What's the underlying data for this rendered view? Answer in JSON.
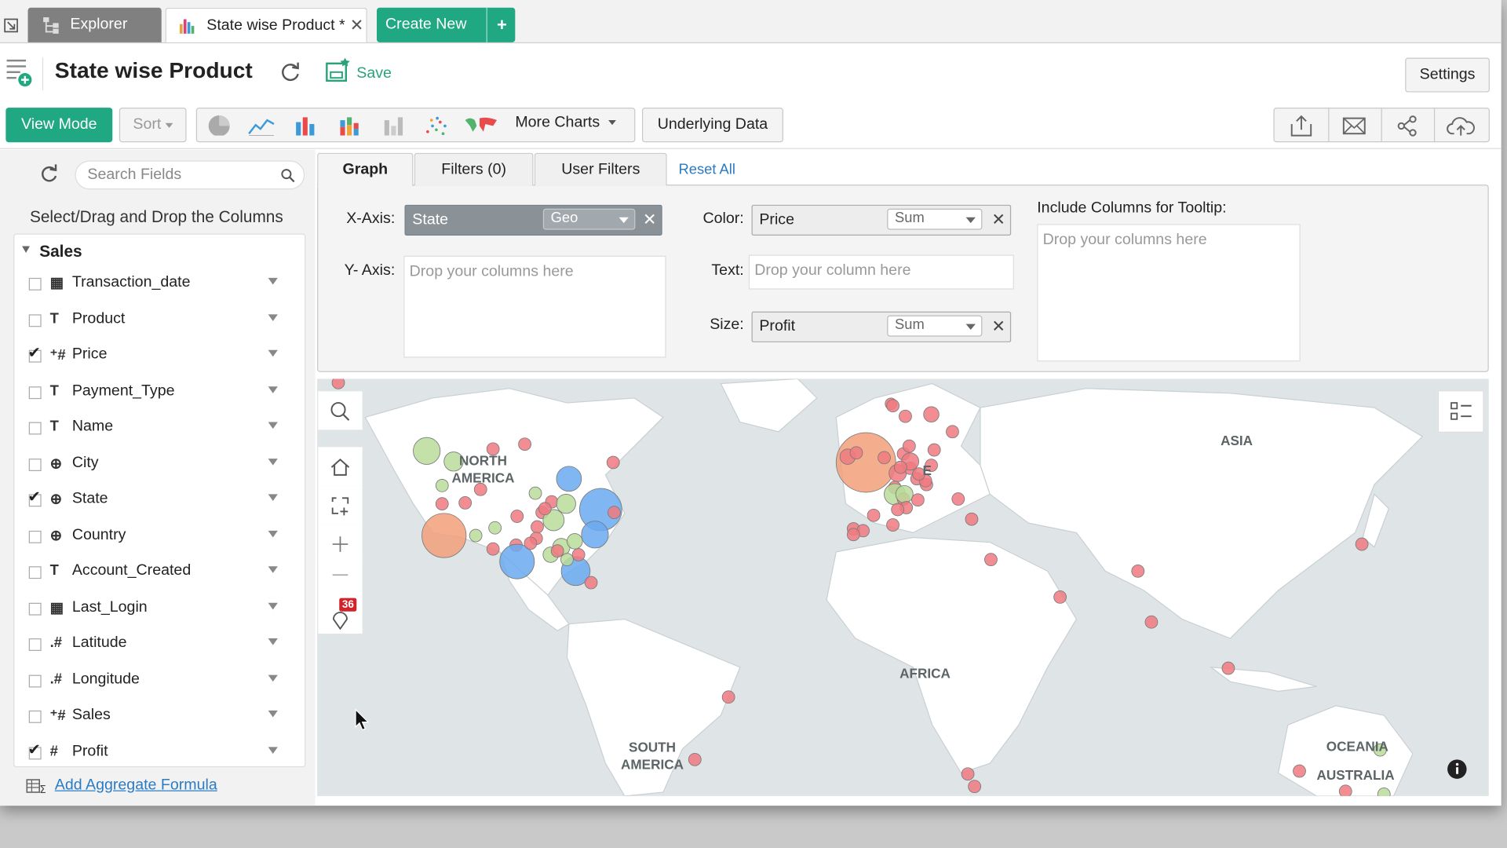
{
  "tabs": {
    "explorer_label": "Explorer",
    "active_label": "State wise Product *",
    "create_new_label": "Create New"
  },
  "header": {
    "title": "State wise Product",
    "save_label": "Save",
    "settings_label": "Settings"
  },
  "toolbar": {
    "view_mode_label": "View Mode",
    "sort_label": "Sort",
    "more_charts_label": "More Charts",
    "underlying_data_label": "Underlying Data",
    "chart_icons": [
      "pie-chart-icon",
      "line-chart-icon",
      "bar-chart-icon",
      "stacked-bar-chart-icon",
      "grayed-bar-chart-icon",
      "scatter-chart-icon",
      "geo-map-chart-icon"
    ],
    "action_icons": [
      "export-icon",
      "email-icon",
      "share-icon",
      "cloud-upload-icon"
    ]
  },
  "left_panel": {
    "search_placeholder": "Search Fields",
    "instruction": "Select/Drag and Drop the Columns",
    "group_label": "Sales",
    "fields": [
      {
        "name": "Transaction_date",
        "type": "date",
        "checked": false
      },
      {
        "name": "Product",
        "type": "text",
        "checked": false
      },
      {
        "name": "Price",
        "type": "measure",
        "checked": true
      },
      {
        "name": "Payment_Type",
        "type": "text",
        "checked": false
      },
      {
        "name": "Name",
        "type": "text",
        "checked": false
      },
      {
        "name": "City",
        "type": "geo",
        "checked": false
      },
      {
        "name": "State",
        "type": "geo",
        "checked": true
      },
      {
        "name": "Country",
        "type": "geo",
        "checked": false
      },
      {
        "name": "Account_Created",
        "type": "text",
        "checked": false
      },
      {
        "name": "Last_Login",
        "type": "date",
        "checked": false
      },
      {
        "name": "Latitude",
        "type": "decimal",
        "checked": false
      },
      {
        "name": "Longitude",
        "type": "decimal",
        "checked": false
      },
      {
        "name": "Sales",
        "type": "measure",
        "checked": false
      },
      {
        "name": "Profit",
        "type": "number",
        "checked": true
      }
    ],
    "add_aggregate_label": "Add Aggregate Formula"
  },
  "config": {
    "tabs": [
      "Graph",
      "Filters (0)",
      "User Filters"
    ],
    "reset_all_label": "Reset All",
    "x_axis_label": "X-Axis:",
    "x_axis_value": "State",
    "x_axis_agg": "Geo",
    "y_axis_label": "Y- Axis:",
    "y_axis_placeholder": "Drop your columns here",
    "color_label": "Color:",
    "color_value": "Price",
    "color_agg": "Sum",
    "text_label": "Text:",
    "text_placeholder": "Drop your column here",
    "size_label": "Size:",
    "size_value": "Profit",
    "size_agg": "Sum",
    "tooltip_label": "Include Columns for Tooltip:",
    "tooltip_placeholder": "Drop your columns here"
  },
  "map": {
    "marker_count_badge": "36",
    "labels": {
      "north_america_1": "NORTH",
      "north_america_2": "AMERICA",
      "europe_fragment": "E",
      "asia": "ASIA",
      "africa": "AFRICA",
      "south_america_1": "SOUTH",
      "south_america_2": "AMERICA",
      "oceania": "OCEANIA",
      "australia": "AUSTRALIA"
    },
    "colors": {
      "red": "#f07a80",
      "orange": "#f2a07a",
      "green": "#b8dc9a",
      "blue": "#6aaaf0"
    }
  }
}
